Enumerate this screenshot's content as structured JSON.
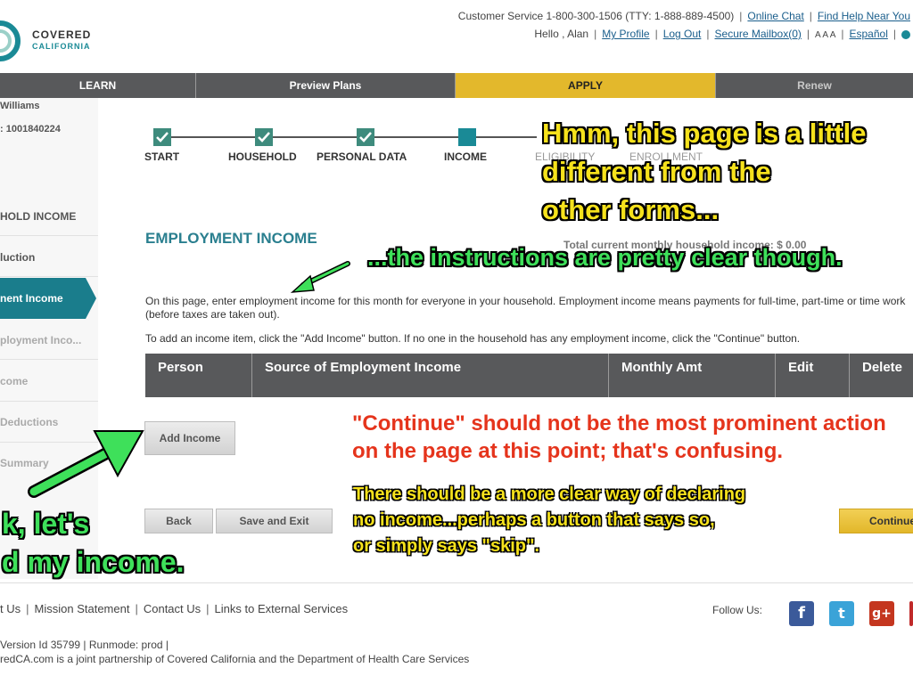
{
  "header": {
    "logo_line1": "COVERED",
    "logo_line2": "CALIFORNIA",
    "customer_service": "Customer Service 1-800-300-1506 (TTY: 1-888-889-4500)",
    "online_chat": "Online Chat",
    "find_help": "Find Help Near You",
    "hello": "Hello , Alan",
    "my_profile": "My Profile",
    "log_out": "Log Out",
    "secure_mailbox": "Secure Mailbox(0)",
    "text_size": "A A A",
    "espanol": "Español"
  },
  "nav": {
    "learn": "LEARN",
    "preview_plans": "Preview Plans",
    "apply": "APPLY",
    "renew": "Renew"
  },
  "sidebar": {
    "user_name": "Williams",
    "case_id": ": 1001840224",
    "items": [
      "HOLD INCOME",
      "luction",
      "nent Income",
      "ployment Inco...",
      "come",
      "Deductions",
      "Summary"
    ]
  },
  "progress": {
    "steps": [
      "START",
      "HOUSEHOLD",
      "PERSONAL DATA",
      "INCOME",
      "ELIGIBILITY",
      "ENROLLMENT"
    ]
  },
  "main": {
    "section_title": "EMPLOYMENT INCOME",
    "total_income": "Total current monthly household income: $ 0.00",
    "para1": "On this page, enter employment income for this month for everyone in your household. Employment income means payments for full-time, part-time or time work (before taxes are taken out).",
    "para2": "To add an income item, click the \"Add Income\" button. If no one in the household has any employment income, click the \"Continue\" button.",
    "table_headers": [
      "Person",
      "Source of Employment Income",
      "Monthly Amt",
      "Edit",
      "Delete"
    ],
    "add_income": "Add Income",
    "back": "Back",
    "save_exit": "Save and Exit",
    "continue": "Continue"
  },
  "annotations": {
    "hmm_1": "Hmm, this page is a little",
    "hmm_2": "different from the",
    "hmm_3": "other forms...",
    "instructions": "...the instructions are pretty clear though.",
    "red_1": "\"Continue\" should not be the most prominent action",
    "red_2": "on the page at this point; that's confusing.",
    "yellow_1": "There should be a more clear way of declaring",
    "yellow_2": "no income...perhaps a button that says so,",
    "yellow_3": "or simply says \"skip\".",
    "green_1": "k, let's",
    "green_2": "d my income."
  },
  "footer": {
    "links": [
      "t Us",
      "Mission Statement",
      "Contact Us",
      "Links to External Services"
    ],
    "version": "Version Id 35799  |  Runmode: prod  |",
    "copyright": "redCA.com is a joint partnership of Covered California and the Department of Health Care Services",
    "follow_us": "Follow Us:"
  },
  "colors": {
    "nav_dark": "#58595b",
    "nav_active": "#e3b82c",
    "teal": "#2a7f8f",
    "annotation_yellow": "#f6e21c",
    "annotation_green": "#3ee05a",
    "annotation_red": "#e5341c"
  }
}
